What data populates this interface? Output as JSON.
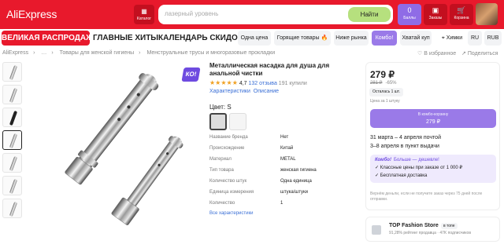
{
  "header": {
    "logo": "AliExpress",
    "catalog_label": "Каталог",
    "search_placeholder": "лазерный уровень",
    "search_button": "Найти",
    "bonus_count": "0",
    "bonus_label": "Баллы",
    "orders_label": "Заказы",
    "cart_label": "Корзина",
    "colors": {
      "brand": "#e8192c",
      "search_button": "#b6e07e",
      "bonus": "#8f6ce6"
    }
  },
  "nav": {
    "items": [
      "ВЕЛИКАЯ РАСПРОДАЖА",
      "ГЛАВНЫЕ ХИТЫ",
      "КАЛЕНДАРЬ СКИДОК",
      "Одна цена",
      "Горящие товары 🔥",
      "Ниже рынка",
      "Комбо!",
      "Хватай куп",
      "Химки",
      "RU",
      "RUB"
    ]
  },
  "breadcrumbs": [
    "AliExpress",
    "…",
    "Товары для женской гигиены",
    "Менструальные трусы и многоразовые прокладки"
  ],
  "actions": {
    "favorite": "В избранное",
    "share": "Поделиться"
  },
  "product": {
    "badge": "КО!",
    "title": "Металлическая насадка для душа для анальной чистки",
    "rating": "4,7",
    "reviews": "132 отзыва",
    "bought": "191 купили",
    "tab_specs": "Характеристики",
    "tab_desc": "Описание",
    "color_label": "Цвет: S",
    "specs": [
      {
        "key": "Название бренда",
        "value": "Нет"
      },
      {
        "key": "Происхождение",
        "value": "Китай"
      },
      {
        "key": "Материал",
        "value": "METAL"
      },
      {
        "key": "Тип товара",
        "value": "женская гигиена"
      },
      {
        "key": "Количество штук",
        "value": "Одна единица"
      },
      {
        "key": "Единица измерения",
        "value": "штука/штуки"
      },
      {
        "key": "Количество",
        "value": "1"
      }
    ],
    "all_specs": "Все характеристики"
  },
  "price_card": {
    "price": "279 ₽",
    "old_price": "281 ₽",
    "discount": "-65%",
    "left": "Осталась 1 шт.",
    "per_piece": "Цена за 1 штуку",
    "buy_sub": "В комбо-корзину",
    "buy_price": "279 ₽",
    "delivery_1": "31 марта – 4 апреля почтой",
    "delivery_2": "3–8 апреля в пункт выдачи",
    "combo_title": "Комбо!",
    "combo_sub": "Больше — дешевле!",
    "combo_1": "Классные цены при заказе от 1 000 ₽",
    "combo_2": "Бесплатная доставка",
    "note": "Вернём деньли, если не получите заказ через 75 дней после отправки."
  },
  "store": {
    "name": "TOP Fashion Store",
    "tag": "в топе",
    "rating": "91,28% рейтинг продавца",
    "subs": "47K подписчиков"
  }
}
